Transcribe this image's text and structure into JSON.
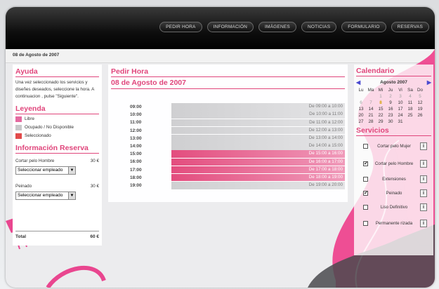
{
  "nav": [
    "PEDIR HORA",
    "INFORMACIÓN",
    "IMÁGENES",
    "NOTICIAS",
    "FORMULARIO",
    "RESERVAS"
  ],
  "crumb_date": "08 de Agosto de 2007",
  "ayuda": {
    "title": "Ayuda",
    "text": "Una vez seleccionado los servicios y diseñes deseados, seleccione la hora. A continuacion , pulse \"Siguiente\"."
  },
  "leyenda": {
    "title": "Leyenda",
    "items": [
      {
        "label": "Libre",
        "color": "#e46aa0"
      },
      {
        "label": "Ocupado / No Disponible",
        "color": "#c8c8ca"
      },
      {
        "label": "Seleccionado",
        "color": "#e24b4b"
      }
    ]
  },
  "reserva": {
    "title": "Información Reserva",
    "services": [
      {
        "name": "Cortar pelo Hombre",
        "price": "30 €",
        "select": "Seleccionar empleado"
      },
      {
        "name": "Peinado",
        "price": "30 €",
        "select": "Seleccionar empleado"
      }
    ],
    "total_label": "Total",
    "total_value": "60 €"
  },
  "pedir": {
    "title": "Pedir Hora",
    "date": "08 de Agosto de 2007",
    "slots": [
      {
        "time": "09:00",
        "range": "De 09:00 a 10:00",
        "state": "occ"
      },
      {
        "time": "10:00",
        "range": "De 10:00 a 11:00",
        "state": "occ"
      },
      {
        "time": "11:00",
        "range": "De 11:00 a 12:00",
        "state": "occ"
      },
      {
        "time": "12:00",
        "range": "De 12:00 a 13:00",
        "state": "occ"
      },
      {
        "time": "13:00",
        "range": "De 13:00 a 14:00",
        "state": "occ"
      },
      {
        "time": "14:00",
        "range": "De 14:00 a 15:00",
        "state": "occ"
      },
      {
        "time": "15:00",
        "range": "De 15:00 a 16:00",
        "state": "sel"
      },
      {
        "time": "16:00",
        "range": "De 16:00 a 17:00",
        "state": "sel"
      },
      {
        "time": "17:00",
        "range": "De 17:00 a 18:00",
        "state": "sel"
      },
      {
        "time": "18:00",
        "range": "De 18:00 a 19:00",
        "state": "sel"
      },
      {
        "time": "19:00",
        "range": "De 19:00 a 20:00",
        "state": "occ"
      }
    ]
  },
  "calendario": {
    "title": "Calendario",
    "month": "Agosto 2007",
    "weekdays": [
      "Lu",
      "Ma",
      "Mi",
      "Ju",
      "Vi",
      "Sa",
      "Do"
    ],
    "days": [
      "",
      "",
      "1",
      "2",
      "3",
      "4",
      "5",
      "6",
      "7",
      "8",
      "9",
      "10",
      "11",
      "12",
      "13",
      "14",
      "15",
      "16",
      "17",
      "18",
      "19",
      "20",
      "21",
      "22",
      "23",
      "24",
      "25",
      "26",
      "27",
      "28",
      "29",
      "30",
      "31"
    ],
    "today": "8"
  },
  "servicios": {
    "title": "Servicios",
    "items": [
      {
        "label": "Cortar pelo Mujer",
        "checked": false
      },
      {
        "label": "Cortar pelo Hombre",
        "checked": true
      },
      {
        "label": "Extensiones",
        "checked": false
      },
      {
        "label": "Peinado",
        "checked": true
      },
      {
        "label": "Liso Definitivo",
        "checked": false
      },
      {
        "label": "Permanente rizada",
        "checked": false
      }
    ],
    "info_icon": "i"
  }
}
